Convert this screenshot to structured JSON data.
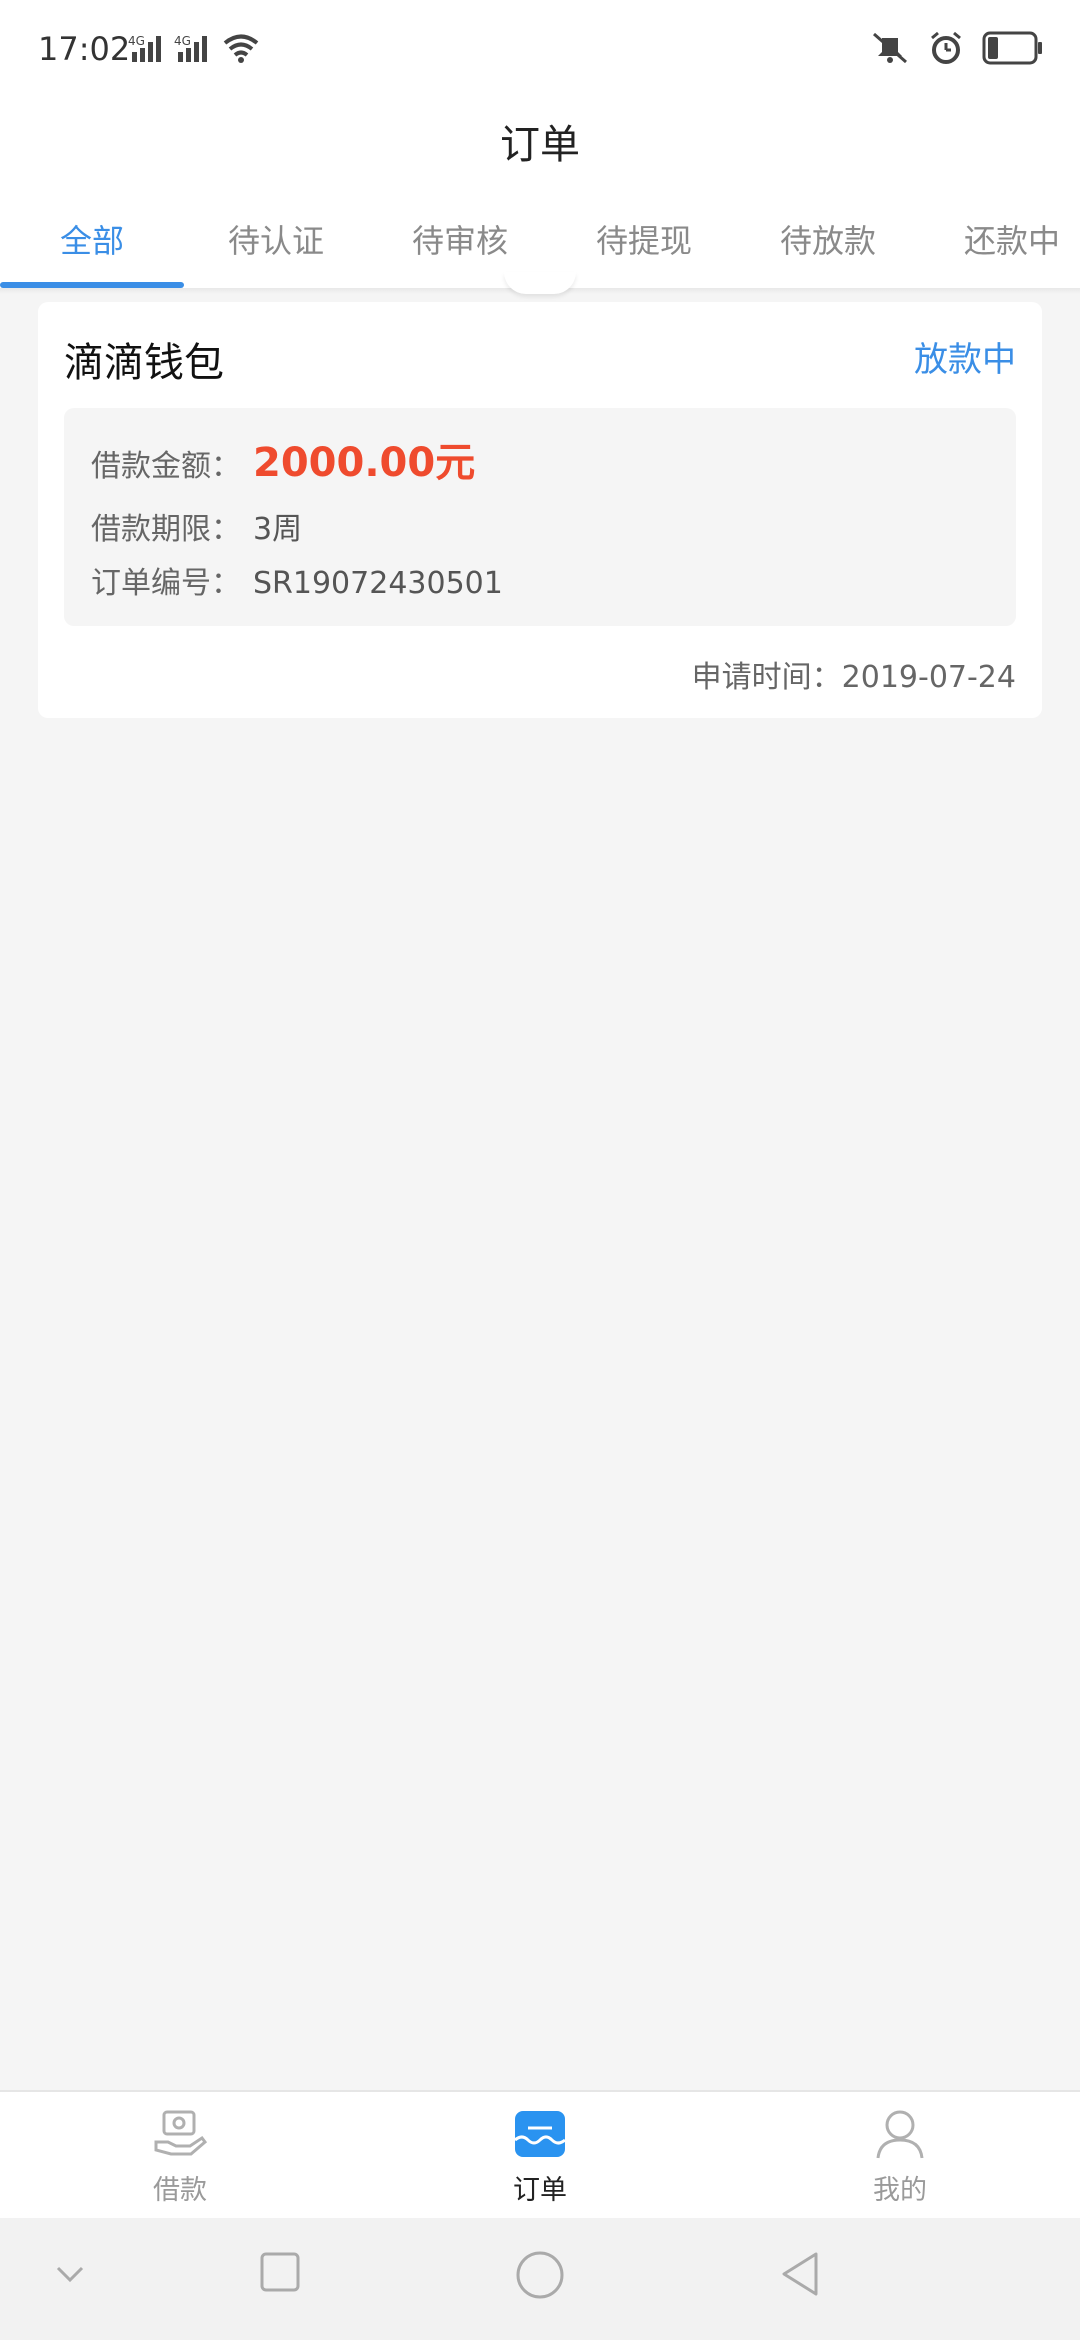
{
  "status_bar": {
    "time": "17:02",
    "icons": [
      "signal-4g-icon",
      "signal-4g-icon",
      "wifi-icon",
      "mute-icon",
      "alarm-icon",
      "battery-icon"
    ]
  },
  "header": {
    "title": "订单"
  },
  "tabs": [
    {
      "label": "全部",
      "active": true
    },
    {
      "label": "待认证",
      "active": false
    },
    {
      "label": "待审核",
      "active": false
    },
    {
      "label": "待提现",
      "active": false
    },
    {
      "label": "待放款",
      "active": false
    },
    {
      "label": "还款中",
      "active": false
    }
  ],
  "order": {
    "title": "滴滴钱包",
    "status": "放款中",
    "amount_label": "借款金额：",
    "amount_value": "2000.00元",
    "term_label": "借款期限：",
    "term_value": "3周",
    "order_no_label": "订单编号：",
    "order_no_value": "SR19072430501",
    "apply_time": "申请时间：2019-07-24"
  },
  "bottom_nav": [
    {
      "label": "借款",
      "icon": "loan-icon",
      "active": false
    },
    {
      "label": "订单",
      "icon": "order-icon",
      "active": true
    },
    {
      "label": "我的",
      "icon": "profile-icon",
      "active": false
    }
  ],
  "colors": {
    "accent": "#3a8ee6",
    "amount": "#ef4b2e",
    "background": "#f5f5f5"
  }
}
